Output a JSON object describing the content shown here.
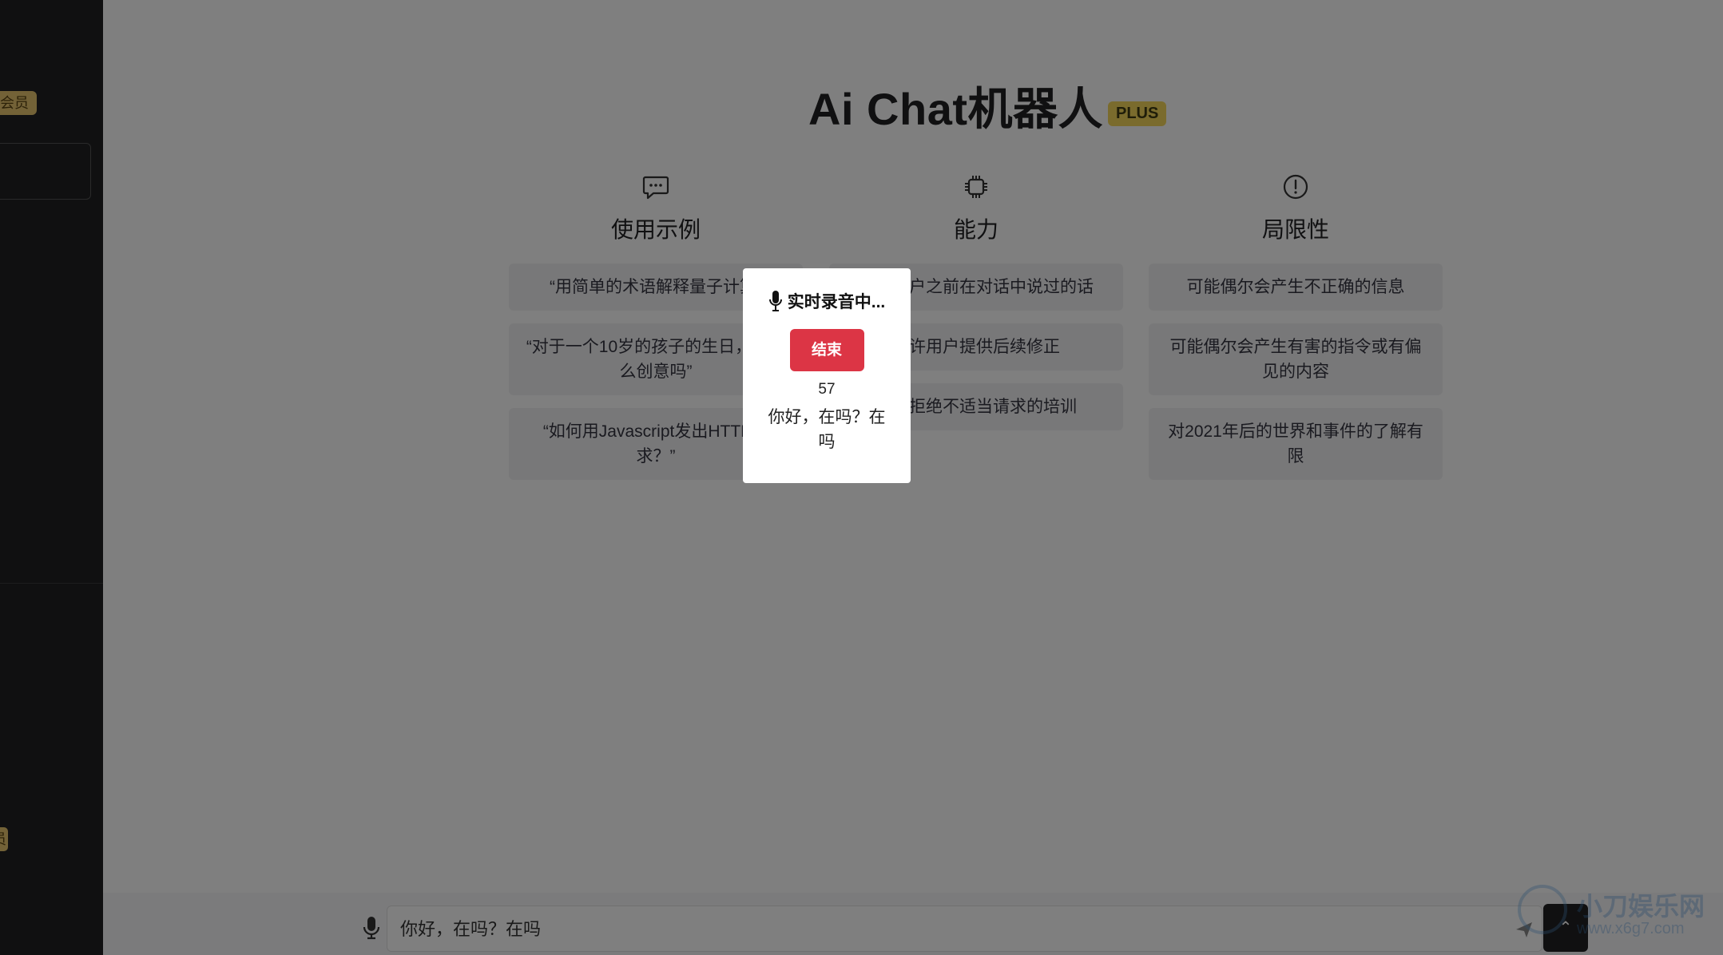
{
  "sidebar": {
    "top_badge": "会员",
    "bottom_badge": "员"
  },
  "main": {
    "title": "Ai Chat机器人",
    "title_badge": "PLUS",
    "columns": [
      {
        "icon": "chat-bubble-icon",
        "heading": "使用示例",
        "cards": [
          "“用简单的术语解释量子计算”",
          "“对于一个10岁的孩子的生日，有什么创意吗”",
          "“如何用Javascript发出HTTP请求？”"
        ]
      },
      {
        "icon": "cpu-chip-icon",
        "heading": "能力",
        "cards": [
          "记住用户之前在对话中说过的话",
          "允许用户提供后续修正",
          "受过拒绝不适当请求的培训"
        ]
      },
      {
        "icon": "warning-circle-icon",
        "heading": "局限性",
        "cards": [
          "可能偶尔会产生不正确的信息",
          "可能偶尔会产生有害的指令或有偏见的内容",
          "对2021年后的世界和事件的了解有限"
        ]
      }
    ]
  },
  "input": {
    "value": "你好，在吗？在吗"
  },
  "modal": {
    "title": "实时录音中...",
    "end_button": "结束",
    "timer": "57",
    "transcript": "你好，在吗？在吗"
  },
  "scroll_top": "⌃",
  "watermark": {
    "line1": "小刀娱乐网",
    "line2": "www.x6g7.com"
  },
  "colors": {
    "sidebar": "#202123",
    "end_button": "#dc3545",
    "plus_badge": "#f5d65a",
    "member_badge": "#e6c46e",
    "card_bg": "#f1f1f3"
  }
}
